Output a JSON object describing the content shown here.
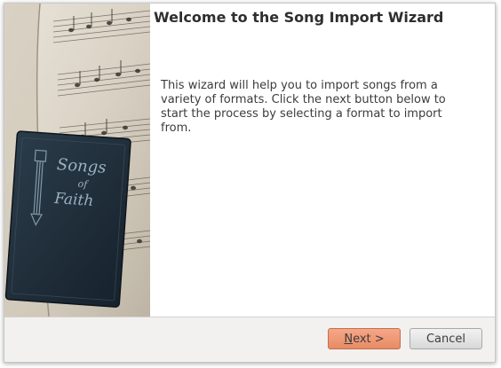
{
  "wizard": {
    "title": "Welcome to the Song Import Wizard",
    "description": "This wizard will help you to import songs from a variety of formats. Click the next button below to start the process by selecting a format to import from.",
    "side_image": {
      "book_title_line1": "Songs",
      "book_title_line2": "of",
      "book_title_line3": "Faith"
    }
  },
  "buttons": {
    "next_mnemonic": "N",
    "next_rest": "ext >",
    "cancel": "Cancel"
  },
  "colors": {
    "next_button": "#e78b64",
    "book_cover": "#1f2e3a",
    "title_text": "#2e2e2e"
  }
}
